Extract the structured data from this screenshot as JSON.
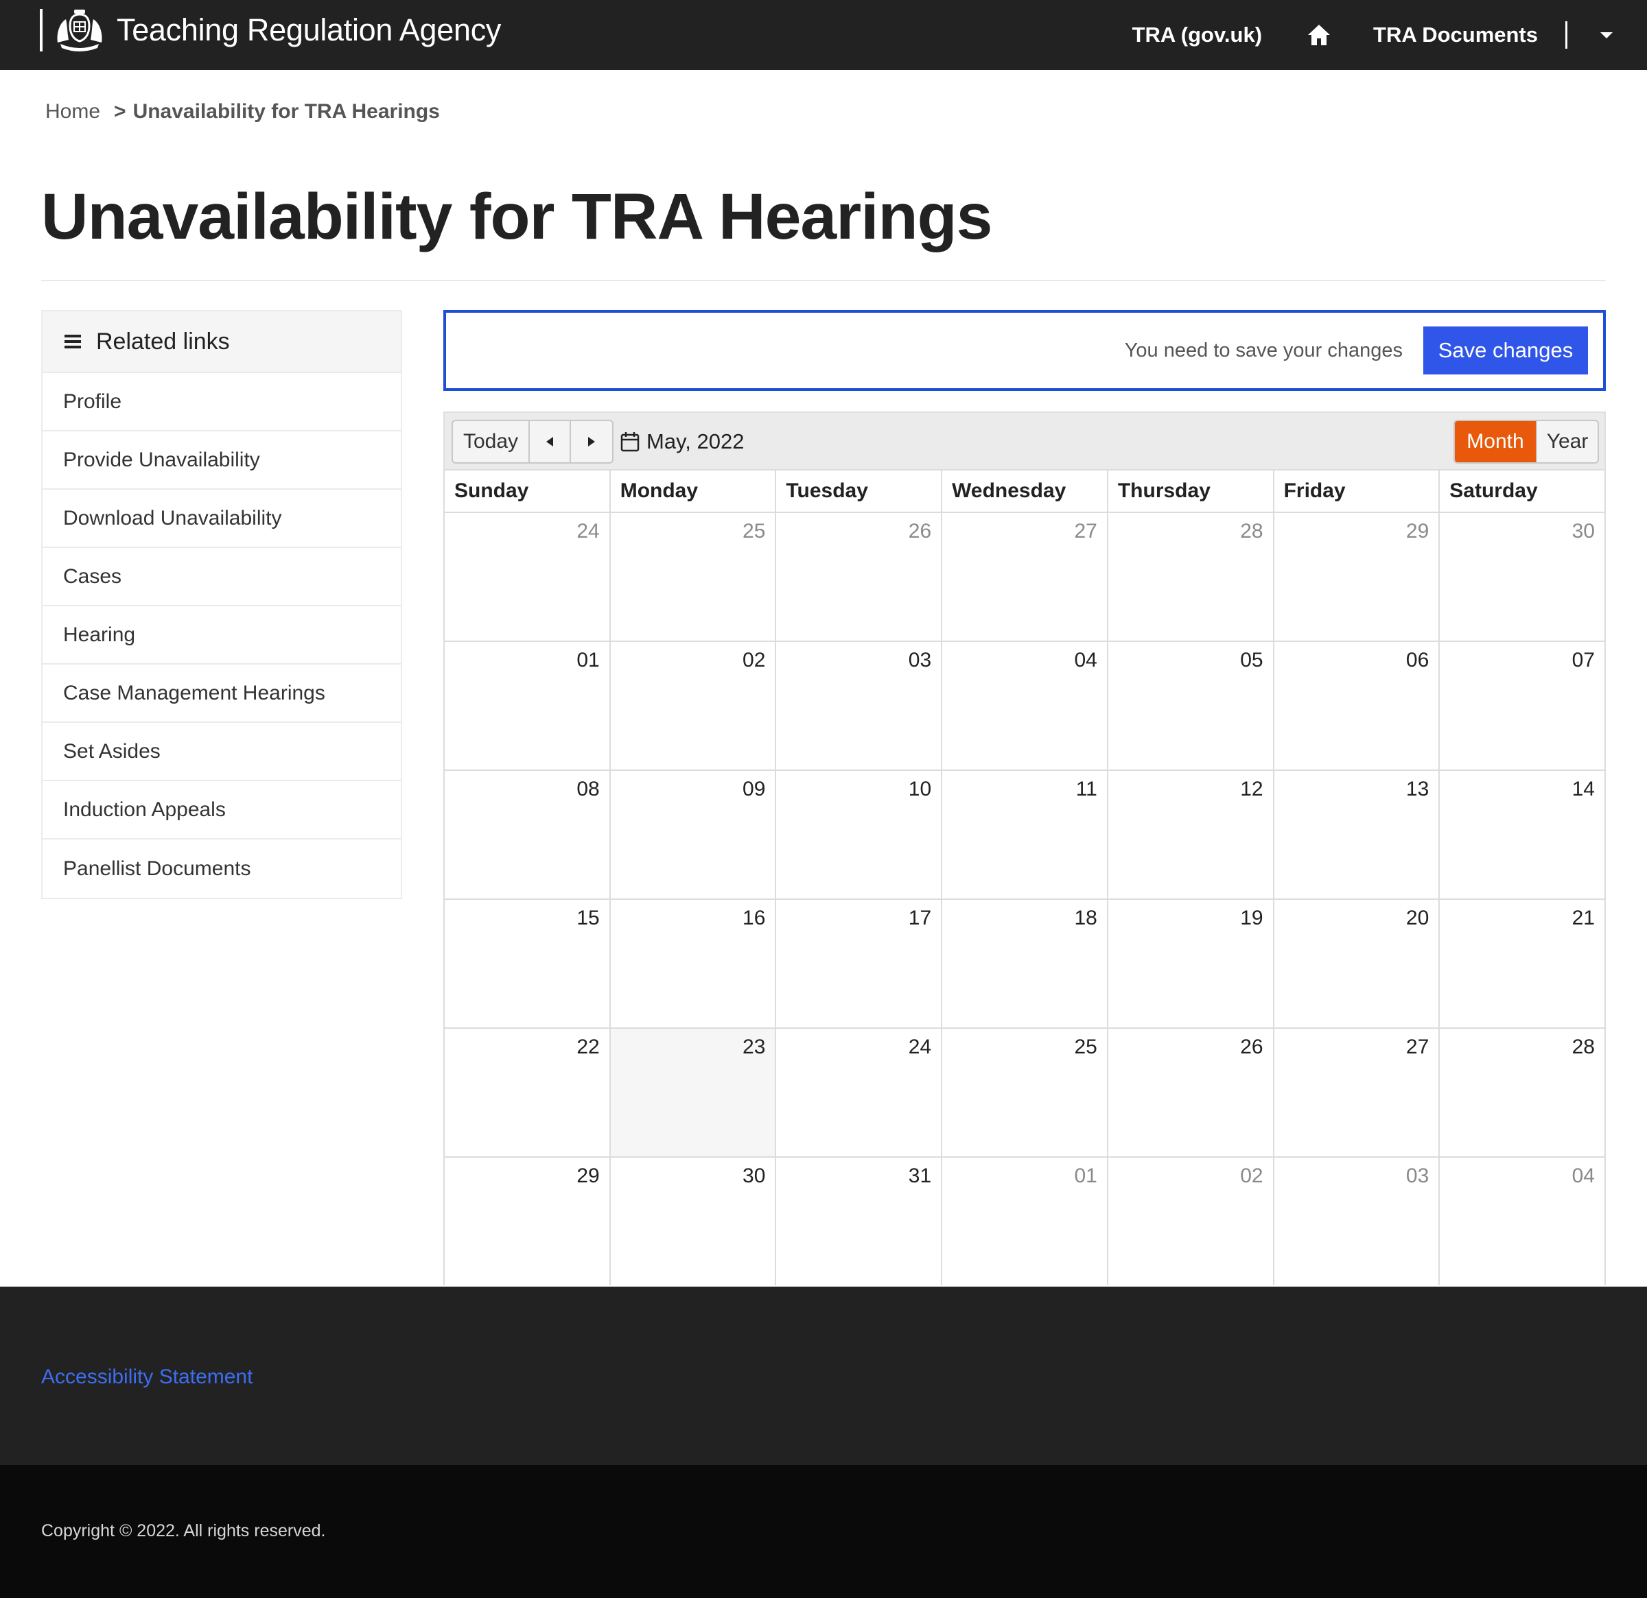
{
  "header": {
    "brand": "Teaching Regulation Agency",
    "nav": {
      "gov_link": "TRA (gov.uk)",
      "home_icon": "home-icon",
      "docs_link": "TRA Documents",
      "menu_icon": "caret-down-icon"
    }
  },
  "breadcrumb": {
    "home": "Home",
    "separator": ">",
    "current": "Unavailability for TRA Hearings"
  },
  "page_title": "Unavailability for TRA Hearings",
  "sidebar": {
    "title": "Related links",
    "icon": "hamburger-icon",
    "items": [
      {
        "label": "Profile"
      },
      {
        "label": "Provide Unavailability"
      },
      {
        "label": "Download Unavailability"
      },
      {
        "label": "Cases"
      },
      {
        "label": "Hearing"
      },
      {
        "label": "Case Management Hearings"
      },
      {
        "label": "Set Asides"
      },
      {
        "label": "Induction Appeals"
      },
      {
        "label": "Panellist Documents"
      }
    ]
  },
  "save_banner": {
    "message": "You need to save your changes",
    "button_label": "Save changes"
  },
  "calendar": {
    "today_label": "Today",
    "period_label": "May, 2022",
    "views": {
      "month": "Month",
      "year": "Year"
    },
    "active_view": "Month",
    "weekdays": [
      "Sunday",
      "Monday",
      "Tuesday",
      "Wednesday",
      "Thursday",
      "Friday",
      "Saturday"
    ],
    "weeks": [
      [
        {
          "day": "24",
          "other": true
        },
        {
          "day": "25",
          "other": true
        },
        {
          "day": "26",
          "other": true
        },
        {
          "day": "27",
          "other": true
        },
        {
          "day": "28",
          "other": true
        },
        {
          "day": "29",
          "other": true
        },
        {
          "day": "30",
          "other": true
        }
      ],
      [
        {
          "day": "01"
        },
        {
          "day": "02"
        },
        {
          "day": "03"
        },
        {
          "day": "04"
        },
        {
          "day": "05"
        },
        {
          "day": "06"
        },
        {
          "day": "07"
        }
      ],
      [
        {
          "day": "08"
        },
        {
          "day": "09"
        },
        {
          "day": "10"
        },
        {
          "day": "11"
        },
        {
          "day": "12"
        },
        {
          "day": "13"
        },
        {
          "day": "14"
        }
      ],
      [
        {
          "day": "15"
        },
        {
          "day": "16"
        },
        {
          "day": "17"
        },
        {
          "day": "18"
        },
        {
          "day": "19"
        },
        {
          "day": "20"
        },
        {
          "day": "21"
        }
      ],
      [
        {
          "day": "22"
        },
        {
          "day": "23",
          "today": true
        },
        {
          "day": "24"
        },
        {
          "day": "25"
        },
        {
          "day": "26"
        },
        {
          "day": "27"
        },
        {
          "day": "28"
        }
      ],
      [
        {
          "day": "29"
        },
        {
          "day": "30"
        },
        {
          "day": "31"
        },
        {
          "day": "01",
          "other": true
        },
        {
          "day": "02",
          "other": true
        },
        {
          "day": "03",
          "other": true
        },
        {
          "day": "04",
          "other": true
        }
      ]
    ]
  },
  "footer": {
    "accessibility_link": "Accessibility Statement",
    "copyright": "Copyright © 2022. All rights reserved."
  },
  "colors": {
    "header_bg": "#222222",
    "accent_blue": "#2f56e8",
    "banner_border": "#1d4ed8",
    "active_view": "#e8590c",
    "footer_link": "#3d6ef0",
    "footer_bottom_bg": "#0a0a0a"
  }
}
